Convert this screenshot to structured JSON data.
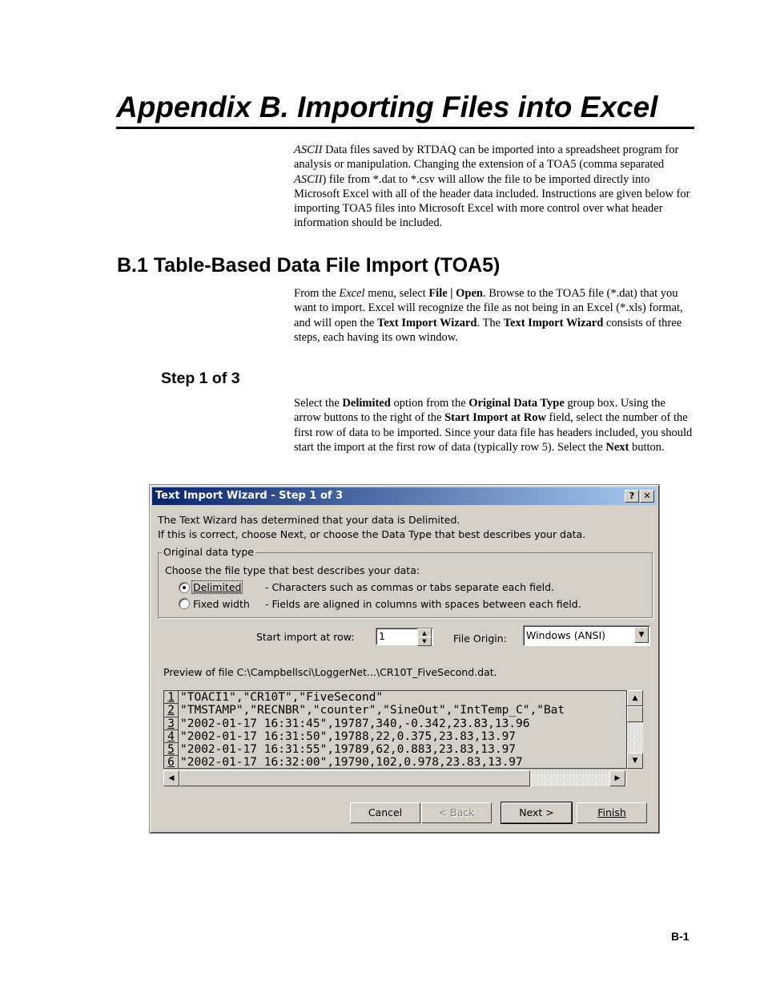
{
  "page": {
    "title": "Appendix B.  Importing Files into Excel",
    "intro": {
      "segments": [
        {
          "t": "ASCII",
          "style": "i"
        },
        {
          "t": " Data files saved by RTDAQ can be imported into a spreadsheet program for analysis or manipulation. Changing the extension of a TOA5 (comma separated "
        },
        {
          "t": "ASCII",
          "style": "i"
        },
        {
          "t": ") file from *.dat to *.csv will allow the file to be imported directly into Microsoft Excel with all of the header data included.  Instructions are given below for importing TOA5 files into Microsoft Excel with more control over what header information should be included."
        }
      ]
    },
    "section_heading": "B.1  Table-Based Data File Import (TOA5)",
    "section_text": {
      "segments": [
        {
          "t": "From the "
        },
        {
          "t": "Excel",
          "style": "i"
        },
        {
          "t": " menu, select "
        },
        {
          "t": "File | Open",
          "style": "b"
        },
        {
          "t": ".  Browse to the TOA5 file (*.dat) that you want to import.  Excel will recognize the file as not being in an Excel (*.xls) format, and will open the "
        },
        {
          "t": "Text Import Wizard",
          "style": "b"
        },
        {
          "t": ".  The "
        },
        {
          "t": "Text Import Wizard",
          "style": "b"
        },
        {
          "t": " consists of three steps, each having its own window."
        }
      ]
    },
    "step_heading": "Step 1 of 3",
    "step_text": {
      "segments": [
        {
          "t": "Select the "
        },
        {
          "t": "Delimited",
          "style": "b"
        },
        {
          "t": " option from the "
        },
        {
          "t": "Original Data Type",
          "style": "b"
        },
        {
          "t": " group box.  Using the arrow buttons to the right of the "
        },
        {
          "t": "Start Import at Row",
          "style": "b"
        },
        {
          "t": " field, select the number of the first row of data to be imported.  Since your data file has headers included, you should start the import at the first row of data (typically row 5).  Select the "
        },
        {
          "t": "Next",
          "style": "b"
        },
        {
          "t": " button."
        }
      ]
    },
    "page_number": "B-1"
  },
  "dialog": {
    "title": "Text Import Wizard - Step 1 of 3",
    "help_btn": "?",
    "close_btn": "✕",
    "line1": "The Text Wizard has determined that your data is Delimited.",
    "line2": "If this is correct, choose Next, or choose the Data Type that best describes your data.",
    "group_label": "Original data type",
    "group_prompt": "Choose the file type that best describes your data:",
    "options": [
      {
        "label": "Delimited",
        "desc": "- Characters such as commas or tabs separate each field.",
        "checked": true
      },
      {
        "label": "Fixed width",
        "desc": "- Fields are aligned in columns with spaces between each field.",
        "checked": false
      }
    ],
    "start_row_label": "Start import at row:",
    "start_row_value": "1",
    "file_origin_label": "File Origin:",
    "file_origin_value": "Windows (ANSI)",
    "preview_label": "Preview of file C:\\Campbellsci\\LoggerNet...\\CR10T_FiveSecond.dat.",
    "preview_rows": [
      {
        "n": "1",
        "text": "\"TOACI1\",\"CR10T\",\"FiveSecond\""
      },
      {
        "n": "2",
        "text": "\"TMSTAMP\",\"RECNBR\",\"counter\",\"SineOut\",\"IntTemp_C\",\"Bat"
      },
      {
        "n": "3",
        "text": "\"2002-01-17 16:31:45\",19787,340,-0.342,23.83,13.96"
      },
      {
        "n": "4",
        "text": "\"2002-01-17 16:31:50\",19788,22,0.375,23.83,13.97"
      },
      {
        "n": "5",
        "text": "\"2002-01-17 16:31:55\",19789,62,0.883,23.83,13.97"
      },
      {
        "n": "6",
        "text": "\"2002-01-17 16:32:00\",19790,102,0.978,23.83,13.97"
      }
    ],
    "buttons": {
      "cancel": "Cancel",
      "back": "< Back",
      "next": "Next >",
      "finish": "Finish"
    }
  }
}
